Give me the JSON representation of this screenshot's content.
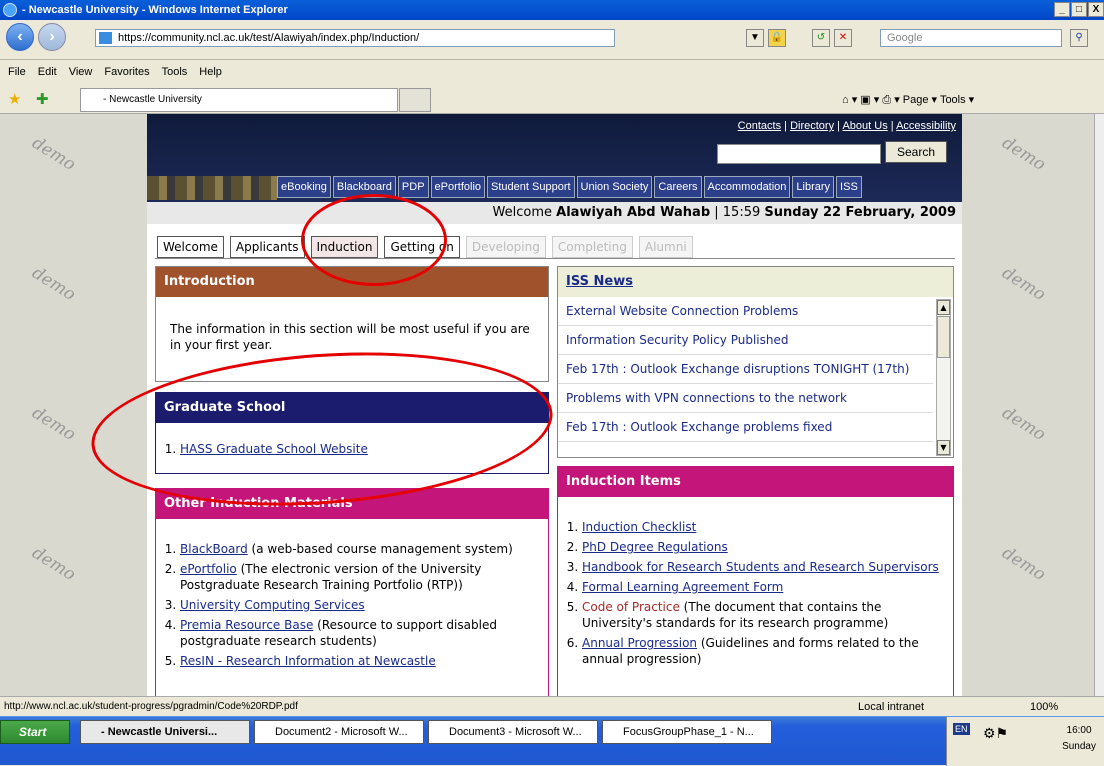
{
  "window": {
    "title": "- Newcastle University - Windows Internet Explorer",
    "controls": [
      "_",
      "□",
      "X"
    ]
  },
  "address_bar": {
    "url": "https://community.ncl.ac.uk/test/Alawiyah/index.php/Induction/",
    "search_placeholder": "Google"
  },
  "menu": [
    "File",
    "Edit",
    "View",
    "Favorites",
    "Tools",
    "Help"
  ],
  "tab": {
    "label": "- Newcastle University"
  },
  "command_bar": {
    "page": "Page",
    "tools": "Tools"
  },
  "watermark": "demo",
  "site": {
    "top_links": [
      "Contacts",
      "Directory",
      "About Us",
      "Accessibility"
    ],
    "search_button": "Search",
    "nav_links": [
      "eBooking",
      "Blackboard",
      "PDP",
      "ePortfolio",
      "Student Support",
      "Union Society",
      "Careers",
      "Accommodation",
      "Library",
      "ISS"
    ],
    "welcome_prefix": "Welcome",
    "welcome_name": "Alawiyah Abd Wahab",
    "welcome_time": "| 15:59",
    "welcome_date": "Sunday 22 February, 2009",
    "tabs": [
      "Welcome",
      "Applicants",
      "Induction",
      "Getting on",
      "Developing",
      "Completing",
      "Alumni"
    ],
    "introduction": {
      "title": "Introduction",
      "text": "The information in this section will be most useful if you are in your first year."
    },
    "graduate_school": {
      "title": "Graduate School",
      "items": [
        "HASS Graduate School Website"
      ]
    },
    "other_materials": {
      "title": "Other Induction Materials",
      "items": [
        {
          "link": "BlackBoard",
          "text": " (a web-based course management system)"
        },
        {
          "link": "ePortfolio",
          "text": " (The electronic version of the University Postgraduate Research Training Portfolio (RTP))"
        },
        {
          "link": "University Computing Services",
          "text": ""
        },
        {
          "link": "Premia Resource Base",
          "text": " (Resource to support disabled postgraduate research students)"
        },
        {
          "link": "ResIN - Research Information at Newcastle",
          "text": ""
        }
      ]
    },
    "iss_news": {
      "title": "ISS News",
      "items": [
        "External Website Connection Problems",
        "Information Security Policy Published",
        "Feb 17th : Outlook Exchange disruptions TONIGHT (17th)",
        "Problems with VPN connections to the network",
        "Feb 17th : Outlook Exchange problems fixed"
      ]
    },
    "induction_items": {
      "title": "Induction Items",
      "items": [
        {
          "link": "Induction Checklist",
          "text": ""
        },
        {
          "link": "PhD Degree Regulations",
          "text": ""
        },
        {
          "link": "Handbook for Research Students and Research Supervisors",
          "text": ""
        },
        {
          "link": "Formal Learning Agreement Form",
          "text": ""
        },
        {
          "link": "Code of Practice",
          "text": " (The document that contains the University's standards for its research programme)"
        },
        {
          "link": "Annual Progression",
          "text": " (Guidelines and forms related to the annual progression)"
        }
      ]
    }
  },
  "status_bar": {
    "url": "http://www.ncl.ac.uk/student-progress/pgradmin/Code%20RDP.pdf",
    "zone": "Local intranet",
    "zoom": "100%"
  },
  "taskbar": {
    "start": "Start",
    "tasks": [
      "- Newcastle Universi...",
      "Document2 - Microsoft W...",
      "Document3 - Microsoft W...",
      "FocusGroupPhase_1 - N..."
    ],
    "lang": "EN",
    "time": "16:00",
    "day": "Sunday"
  },
  "colors": {
    "intro": "#a0522d",
    "grad": "#1c1c6e",
    "other": "#c4157a",
    "induction": "#c4157a",
    "annotation": "#e40000"
  }
}
